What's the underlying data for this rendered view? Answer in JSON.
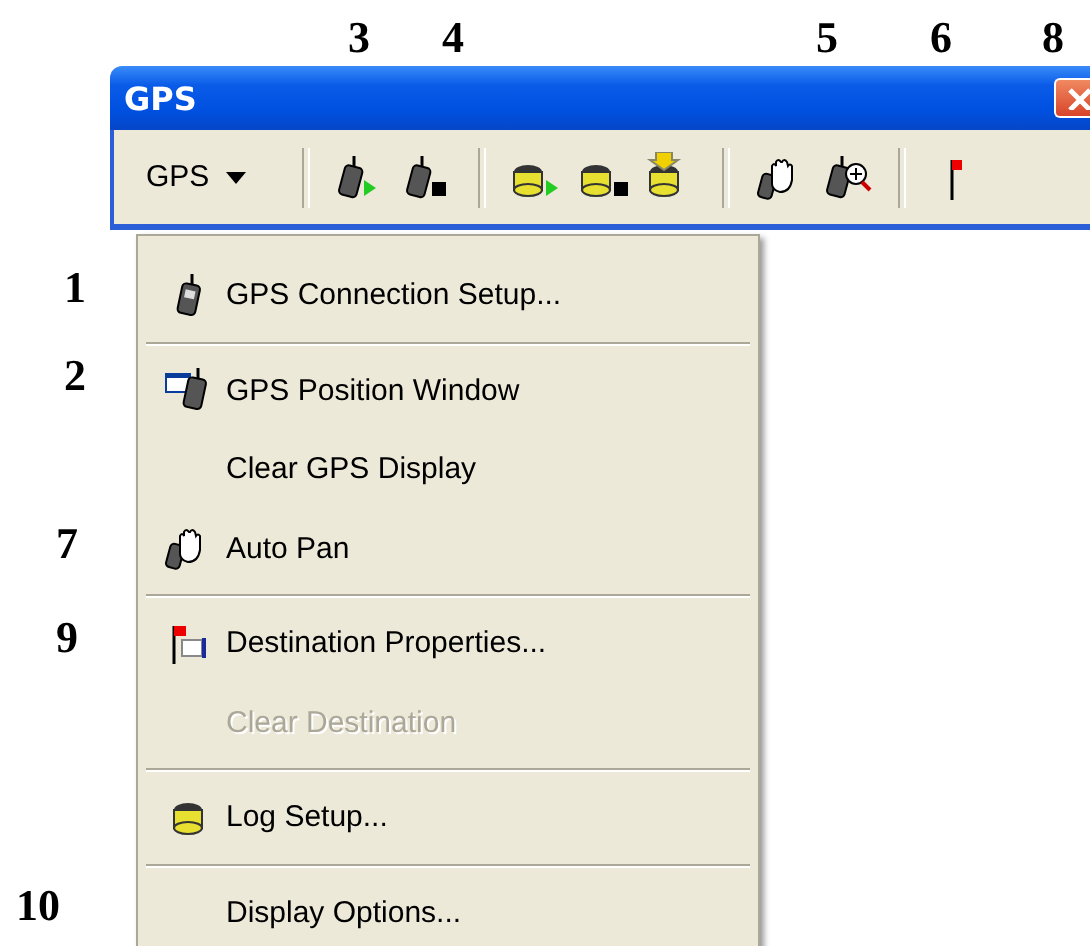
{
  "callouts_top": [
    {
      "label": "3"
    },
    {
      "label": "4"
    },
    {
      "label": "5"
    },
    {
      "label": "6"
    },
    {
      "label": "8"
    }
  ],
  "callouts_side": [
    {
      "label": "1"
    },
    {
      "label": "2"
    },
    {
      "label": "7"
    },
    {
      "label": "9"
    },
    {
      "label": "10"
    }
  ],
  "window": {
    "title": "GPS"
  },
  "toolbar": {
    "dropdown": {
      "label": "GPS"
    }
  },
  "menu": {
    "items": [
      {
        "kind": "item",
        "label": "GPS Connection Setup...",
        "disabled": false
      },
      {
        "kind": "separator"
      },
      {
        "kind": "item",
        "label": "GPS Position Window",
        "disabled": false
      },
      {
        "kind": "item",
        "label": "Clear GPS Display",
        "disabled": false
      },
      {
        "kind": "item",
        "label": "Auto Pan",
        "disabled": false
      },
      {
        "kind": "separator"
      },
      {
        "kind": "item",
        "label": "Destination Properties...",
        "disabled": false
      },
      {
        "kind": "item",
        "label": "Clear Destination",
        "disabled": true
      },
      {
        "kind": "separator"
      },
      {
        "kind": "item",
        "label": "Log Setup...",
        "disabled": false
      },
      {
        "kind": "separator"
      },
      {
        "kind": "item",
        "label": "Display Options...",
        "disabled": false
      }
    ]
  }
}
